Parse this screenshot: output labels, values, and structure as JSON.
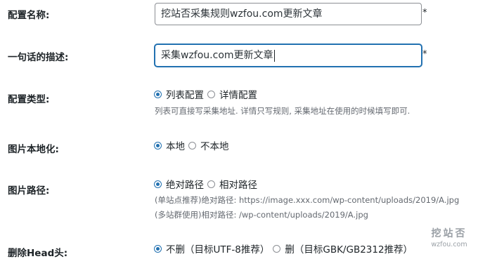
{
  "fields": {
    "config_name": {
      "label": "配置名称:",
      "value": "挖站否采集规则wzfou.com更新文章",
      "required_mark": "*"
    },
    "description": {
      "label": "一句话的描述:",
      "value": "采集wzfou.com更新文章",
      "required_mark": "*"
    },
    "config_type": {
      "label": "配置类型:",
      "options": [
        "列表配置",
        "详情配置"
      ],
      "selected": "列表配置",
      "help": "列表可直接写采集地址. 详情只写规则, 采集地址在使用的时候填写即可."
    },
    "image_localize": {
      "label": "图片本地化:",
      "options": [
        "本地",
        "不本地"
      ],
      "selected": "本地"
    },
    "image_path": {
      "label": "图片路径:",
      "options": [
        "绝对路径",
        "相对路径"
      ],
      "selected": "绝对路径",
      "help_lines": [
        "(单站点推荐)绝对路径: https://image.xxx.com/wp-content/uploads/2019/A.jpg",
        "(多站群使用)相对路径: /wp-content/uploads/2019/A.jpg"
      ]
    },
    "remove_head": {
      "label": "删除Head头:",
      "options": [
        "不删（目标UTF-8推荐）",
        "删（目标GBK/GB2312推荐）"
      ],
      "selected": "不删（目标UTF-8推荐）"
    }
  },
  "watermark": {
    "title": "挖站否",
    "url": "wzfou.com"
  },
  "colors": {
    "accent": "#2271b1",
    "text": "#1d2327",
    "muted": "#646970",
    "border": "#8c8f94"
  }
}
